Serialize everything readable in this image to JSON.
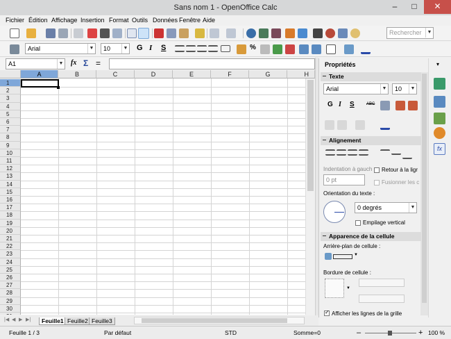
{
  "window": {
    "title": "Sans nom 1 - OpenOffice Calc",
    "minimize": "–",
    "maximize": "□",
    "close": "✕"
  },
  "menu": [
    "Fichier",
    "Édition",
    "Affichage",
    "Insertion",
    "Format",
    "Outils",
    "Données",
    "Fenêtre",
    "Aide"
  ],
  "standard_toolbar": {
    "search_placeholder": "Rechercher"
  },
  "format_toolbar": {
    "font_name": "Arial",
    "font_size": "10",
    "bold": "G",
    "italic": "I",
    "underline": "S",
    "percent": "%",
    "currency": "€"
  },
  "formula_bar": {
    "name_box": "A1",
    "func_wizard": "fx",
    "sum": "Σ",
    "equals": "="
  },
  "columns": [
    "A",
    "B",
    "C",
    "D",
    "E",
    "F",
    "G",
    "H"
  ],
  "rows": [
    "1",
    "2",
    "3",
    "4",
    "5",
    "6",
    "7",
    "8",
    "9",
    "10",
    "11",
    "12",
    "13",
    "14",
    "15",
    "16",
    "17",
    "18",
    "19",
    "20",
    "21",
    "22",
    "23",
    "24",
    "25",
    "26",
    "27",
    "28",
    "29",
    "30",
    "31"
  ],
  "sheet_tabs": [
    "Feuille1",
    "Feuille2",
    "Feuille3"
  ],
  "sidebar": {
    "title": "Propriétés",
    "text_section": "Texte",
    "font_name": "Arial",
    "font_size": "10",
    "bold": "G",
    "italic": "I",
    "underline": "S",
    "strike": "ABC",
    "align_section": "Alignement",
    "indent_label": "Indentation à gauch",
    "indent_value": "0 pt",
    "wrap_label": "Retour à la ligr",
    "merge_label": "Fusionner les c",
    "orientation_label": "Orientation du texte :",
    "orientation_value": "0 degrés",
    "vertical_stack_label": "Empilage vertical",
    "appearance_section": "Apparence de la cellule",
    "background_label": "Arrière-plan de cellule :",
    "border_label": "Bordure de cellule :",
    "show_grid_label": "Afficher les lignes de la grille"
  },
  "status": {
    "sheet": "Feuille 1 / 3",
    "style": "Par défaut",
    "mode": "STD",
    "sum": "Somme=0",
    "zoom": "100 %",
    "zoom_minus": "–",
    "zoom_plus": "+"
  }
}
